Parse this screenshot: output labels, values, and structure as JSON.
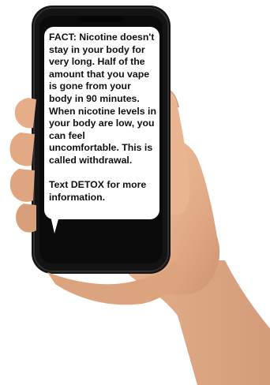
{
  "message": {
    "fact_text": "FACT: Nicotine doesn't stay in your body for very long. Half of the amount that you vape is gone from your body in 90 minutes. When nicotine levels in your body are low, you can feel uncomfortable. This is called withdrawal.",
    "cta_text": "Text DETOX for more information."
  },
  "colors": {
    "phone_body": "#141414",
    "phone_edge": "#2a2a2a",
    "screen": "#0b0b0b",
    "bubble": "#ffffff",
    "skin": "#e6b48e",
    "skin_shadow": "#c98f69"
  }
}
